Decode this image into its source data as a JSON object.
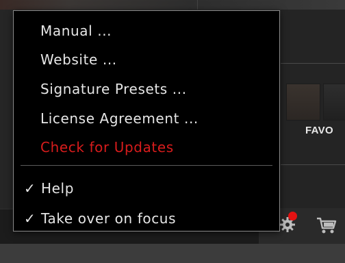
{
  "background_app": {
    "panel_label": "FAVO"
  },
  "menu": {
    "items": [
      {
        "label": "Manual ...",
        "style": "normal"
      },
      {
        "label": "Website ...",
        "style": "normal"
      },
      {
        "label": "Signature Presets ...",
        "style": "normal"
      },
      {
        "label": "License Agreement ...",
        "style": "normal"
      },
      {
        "label": "Check for Updates",
        "style": "danger"
      }
    ],
    "toggle_items": [
      {
        "check": "✓",
        "label": "Help",
        "checked": true
      },
      {
        "check": "✓",
        "label": "Take over on focus",
        "checked": true
      }
    ]
  },
  "toolbar": {
    "settings_icon": "gear-icon",
    "notification_icon": "notification-dot-icon",
    "cart_icon": "shopping-cart-icon"
  },
  "colors": {
    "menu_background": "#000000",
    "menu_text": "#e6e6e6",
    "danger_text": "#d81c1c",
    "notification_dot": "#e31212",
    "menu_border": "#8a8a8a"
  }
}
